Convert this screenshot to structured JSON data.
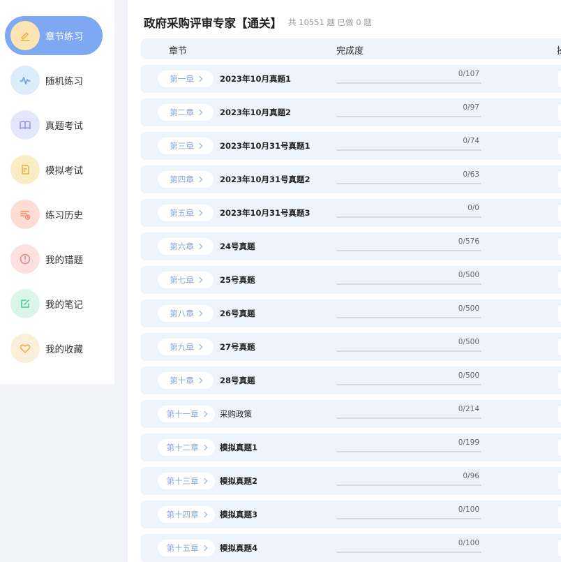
{
  "sidebar": {
    "items": [
      {
        "label": "章节练习",
        "icon": "pencil-icon",
        "icon_bg": "#fbe6b3",
        "icon_color": "#e7b04a",
        "active": true
      },
      {
        "label": "随机练习",
        "icon": "pulse-icon",
        "icon_bg": "#dcecfb",
        "icon_color": "#5a9be6",
        "active": false
      },
      {
        "label": "真题考试",
        "icon": "book-icon",
        "icon_bg": "#e4e7fb",
        "icon_color": "#8a92e6",
        "active": false
      },
      {
        "label": "模拟考试",
        "icon": "document-edit-icon",
        "icon_bg": "#faedc4",
        "icon_color": "#e0b246",
        "active": false
      },
      {
        "label": "练习历史",
        "icon": "history-list-icon",
        "icon_bg": "#fddcd2",
        "icon_color": "#ef8a67",
        "active": false
      },
      {
        "label": "我的错题",
        "icon": "alert-circle-icon",
        "icon_bg": "#fde0e0",
        "icon_color": "#ec7f7f",
        "active": false
      },
      {
        "label": "我的笔记",
        "icon": "note-edit-icon",
        "icon_bg": "#daf6ea",
        "icon_color": "#4fc58f",
        "active": false
      },
      {
        "label": "我的收藏",
        "icon": "heart-icon",
        "icon_bg": "#fcefd8",
        "icon_color": "#e8a94e",
        "active": false
      }
    ]
  },
  "main": {
    "title": "政府采购评审专家【通关】",
    "stats": "共 10551 题 已做 0 题",
    "header": {
      "chapter": "章节",
      "progress": "完成度",
      "operation": "操"
    },
    "rows": [
      {
        "chapter": "第一章",
        "name": "2023年10月真题1",
        "done": 0,
        "total": 107,
        "count": "0/107"
      },
      {
        "chapter": "第二章",
        "name": "2023年10月真题2",
        "done": 0,
        "total": 97,
        "count": "0/97"
      },
      {
        "chapter": "第三章",
        "name": "2023年10月31号真题1",
        "done": 0,
        "total": 74,
        "count": "0/74"
      },
      {
        "chapter": "第四章",
        "name": "2023年10月31号真题2",
        "done": 0,
        "total": 63,
        "count": "0/63"
      },
      {
        "chapter": "第五章",
        "name": "2023年10月31号真题3",
        "done": 0,
        "total": 0,
        "count": "0/0"
      },
      {
        "chapter": "第六章",
        "name": "24号真题",
        "done": 0,
        "total": 576,
        "count": "0/576"
      },
      {
        "chapter": "第七章",
        "name": "25号真题",
        "done": 0,
        "total": 500,
        "count": "0/500"
      },
      {
        "chapter": "第八章",
        "name": "26号真题",
        "done": 0,
        "total": 500,
        "count": "0/500"
      },
      {
        "chapter": "第九章",
        "name": "27号真题",
        "done": 0,
        "total": 500,
        "count": "0/500"
      },
      {
        "chapter": "第十章",
        "name": "28号真题",
        "done": 0,
        "total": 500,
        "count": "0/500"
      },
      {
        "chapter": "第十一章",
        "name": "采购政策",
        "done": 0,
        "total": 214,
        "count": "0/214"
      },
      {
        "chapter": "第十二章",
        "name": "模拟真题1",
        "done": 0,
        "total": 199,
        "count": "0/199"
      },
      {
        "chapter": "第十三章",
        "name": "模拟真题2",
        "done": 0,
        "total": 96,
        "count": "0/96"
      },
      {
        "chapter": "第十四章",
        "name": "模拟真题3",
        "done": 0,
        "total": 100,
        "count": "0/100"
      },
      {
        "chapter": "第十五章",
        "name": "模拟真题4",
        "done": 0,
        "total": 100,
        "count": "0/100"
      }
    ]
  }
}
